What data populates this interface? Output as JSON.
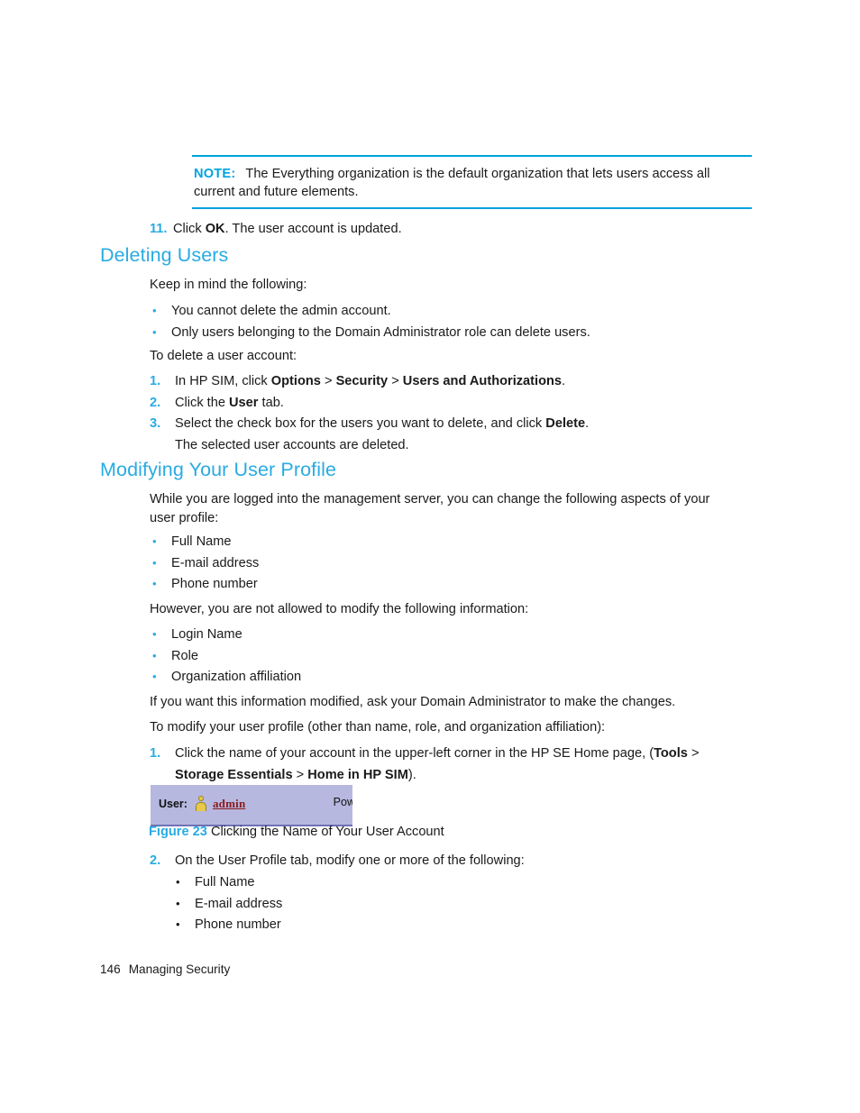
{
  "colors": {
    "accent": "#29ABE2",
    "rule": "#00A3DE",
    "figure_bg": "#b6b8e0",
    "figure_border": "#6f72b5",
    "link": "#8B1A1A",
    "icon": "#e8c84a",
    "text": "#1a1a1a"
  },
  "note": {
    "label": "NOTE:",
    "text": "The Everything organization is the default organization that lets users access all current and future elements."
  },
  "step11": {
    "number": "11.",
    "pre": "Click ",
    "bold": "OK",
    "post": ". The user account is updated."
  },
  "section_deleting": {
    "heading": "Deleting Users",
    "intro": "Keep in mind the following:",
    "bullets": [
      "You cannot delete the admin account.",
      "Only users belonging to the Domain Administrator role can delete users."
    ],
    "lead_in": "To delete a user account:",
    "steps": [
      {
        "number": "1.",
        "segments": [
          {
            "text": "In HP SIM, click ",
            "bold": false
          },
          {
            "text": "Options",
            "bold": true
          },
          {
            "text": " > ",
            "bold": false
          },
          {
            "text": "Security",
            "bold": true
          },
          {
            "text": " > ",
            "bold": false
          },
          {
            "text": "Users and Authorizations",
            "bold": true
          },
          {
            "text": ".",
            "bold": false
          }
        ]
      },
      {
        "number": "2.",
        "segments": [
          {
            "text": "Click the ",
            "bold": false
          },
          {
            "text": "User",
            "bold": true
          },
          {
            "text": " tab.",
            "bold": false
          }
        ]
      },
      {
        "number": "3.",
        "segments": [
          {
            "text": "Select the check box for the users you want to delete, and click ",
            "bold": false
          },
          {
            "text": "Delete",
            "bold": true
          },
          {
            "text": ".",
            "bold": false
          }
        ],
        "continuation": "The selected user accounts are deleted."
      }
    ]
  },
  "section_modifying": {
    "heading": "Modifying Your User Profile",
    "intro_line1": "While you are logged into the management server, you can change the following aspects of your",
    "intro_line2": "user profile:",
    "editable_bullets": [
      "Full Name",
      "E-mail address",
      "Phone number"
    ],
    "restriction_intro": "However, you are not allowed to modify the following information:",
    "restricted_bullets": [
      "Login Name",
      "Role",
      "Organization affiliation"
    ],
    "admin_note": "If you want this information modified, ask your Domain Administrator to make the changes.",
    "lead_in": "To modify your user profile (other than name, role, and organization affiliation):",
    "steps": [
      {
        "number": "1.",
        "segments": [
          {
            "text": "Click the name of your account in the upper-left corner in the HP SE Home page, (",
            "bold": false
          },
          {
            "text": "Tools",
            "bold": true
          },
          {
            "text": " >",
            "bold": false
          }
        ],
        "line2_segments": [
          {
            "text": "Storage Essentials",
            "bold": true
          },
          {
            "text": " > ",
            "bold": false
          },
          {
            "text": "Home in HP SIM",
            "bold": true
          },
          {
            "text": ").",
            "bold": false
          }
        ]
      },
      {
        "number": "2.",
        "segments": [
          {
            "text": "On the User Profile tab, modify one or more of the following:",
            "bold": false
          }
        ],
        "sub_bullets": [
          "Full Name",
          "E-mail address",
          "Phone number"
        ]
      }
    ]
  },
  "figure": {
    "number": "Figure 23",
    "caption": "Clicking the Name of Your User Account",
    "screenshot": {
      "user_label": "User:",
      "person_icon": "person-icon",
      "account_link": "admin",
      "truncated_text": "Pow"
    }
  },
  "footer": {
    "page_number": "146",
    "chapter": "Managing Security"
  }
}
